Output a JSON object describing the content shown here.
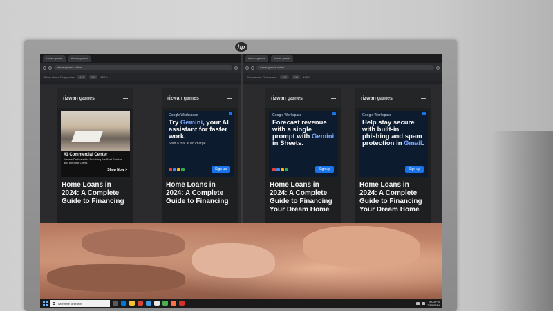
{
  "browser": {
    "windows": [
      {
        "tabs": [
          "rizwan games",
          "rizwan games"
        ],
        "url": "rizwangames.online",
        "devbar": {
          "device": "Dimensions: Responsive",
          "width": "412",
          "height": "915",
          "zoom": "100%"
        }
      },
      {
        "tabs": [
          "rizwan games",
          "rizwan games"
        ],
        "url": "rizwangames.online",
        "devbar": {
          "device": "Dimensions: Responsive",
          "width": "412",
          "height": "915",
          "zoom": "100%"
        }
      }
    ]
  },
  "phones": [
    {
      "brand": "rizwan games",
      "ad": {
        "kind": "photo",
        "title": "#1 Commercial Center",
        "desc": "We are Dedicated to Providing the Best Service and the Best Offers",
        "cta": "Shop Now >"
      },
      "article_title": "Home Loans in 2024: A Complete Guide to Financing"
    },
    {
      "brand": "rizwan games",
      "ad": {
        "kind": "google",
        "workspace": "Google Workspace",
        "headline_pre": "Try ",
        "headline_accent": "Gemini",
        "headline_post": ", your AI assistant for faster work.",
        "sub": "Start a trial at no charge.",
        "cta": "Sign up"
      },
      "article_title": "Home Loans in 2024: A Complete Guide to Financing"
    },
    {
      "brand": "rizwan games",
      "ad": {
        "kind": "google",
        "workspace": "Google Workspace",
        "headline_pre": "Forecast revenue with a single prompt with ",
        "headline_accent": "Gemini",
        "headline_post": " in Sheets.",
        "sub": "",
        "cta": "Sign up"
      },
      "article_title": "Home Loans in 2024: A Complete Guide to Financing Your Dream Home"
    },
    {
      "brand": "rizwan games",
      "ad": {
        "kind": "google",
        "workspace": "Google Workspace",
        "headline_pre": "Help stay secure with built-in phishing and spam protection in ",
        "headline_accent": "Gmail",
        "headline_post": ".",
        "sub": "",
        "cta": "Sign up"
      },
      "article_title": "Home Loans in 2024: A Complete Guide to Financing Your Dream Home"
    }
  ],
  "taskbar": {
    "search_placeholder": "Type here to search",
    "time": "4:00 PM",
    "date": "7/23/2024"
  },
  "colors": {
    "ad_bg": "#0d1b2e",
    "accent_blue": "#7aa6ff",
    "cta_blue": "#1a73e8",
    "page_bg": "#1e1f21"
  }
}
